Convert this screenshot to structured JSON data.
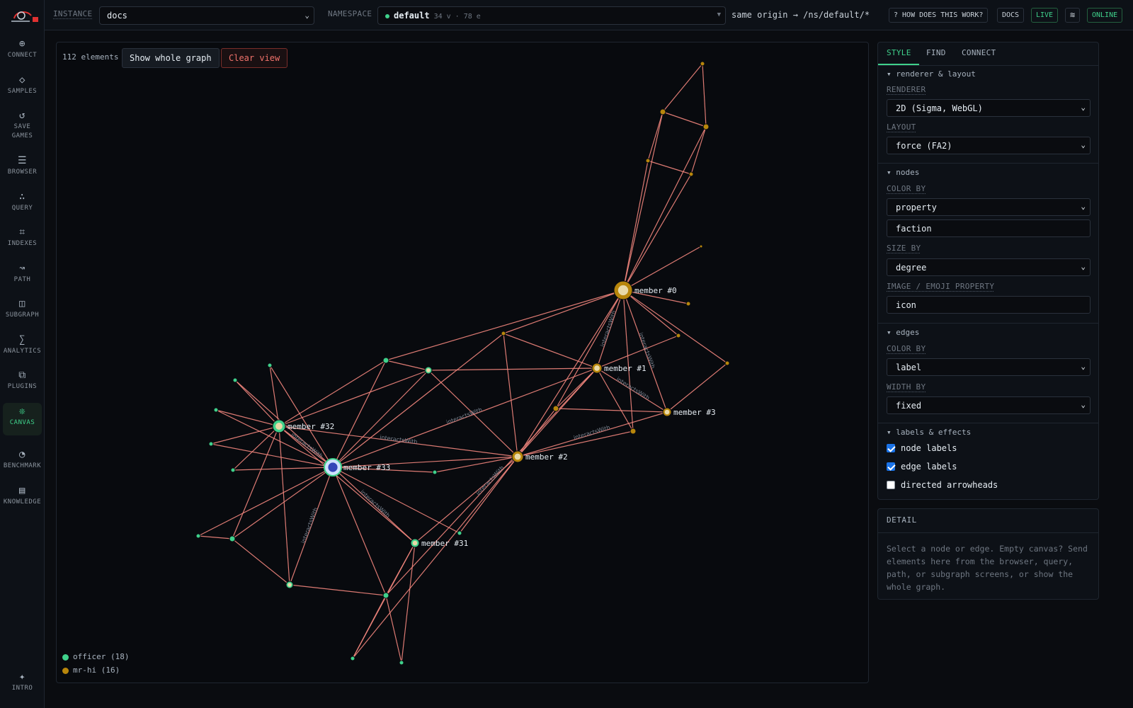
{
  "sidebar": {
    "items": [
      {
        "label": "CONNECT",
        "icon": "plug-icon",
        "glyph": "⊕"
      },
      {
        "label": "SAMPLES",
        "icon": "diamond-icon",
        "glyph": "◇"
      },
      {
        "label": "SAVE",
        "label2": "GAMES",
        "icon": "refresh-icon",
        "glyph": "↺"
      },
      {
        "label": "BROWSER",
        "icon": "list-icon",
        "glyph": "☰"
      },
      {
        "label": "QUERY",
        "icon": "dots-icon",
        "glyph": "∴"
      },
      {
        "label": "INDEXES",
        "icon": "grid-icon",
        "glyph": "⌗"
      },
      {
        "label": "PATH",
        "icon": "path-icon",
        "glyph": "↝"
      },
      {
        "label": "SUBGRAPH",
        "icon": "subgraph-icon",
        "glyph": "◫"
      },
      {
        "label": "ANALYTICS",
        "icon": "sigma-icon",
        "glyph": "∑"
      },
      {
        "label": "PLUGINS",
        "icon": "plugins-icon",
        "glyph": "⧉"
      },
      {
        "label": "CANVAS",
        "icon": "canvas-icon",
        "glyph": "❊"
      },
      {
        "label": "BENCHMARK",
        "icon": "gauge-icon",
        "glyph": "◔"
      },
      {
        "label": "KNOWLEDGE",
        "icon": "book-icon",
        "glyph": "▤"
      }
    ],
    "intro": {
      "label": "INTRO",
      "glyph": "✦"
    }
  },
  "topbar": {
    "instance_label": "INSTANCE",
    "instance_value": "docs",
    "namespace_label": "NAMESPACE",
    "namespace_value": "default",
    "namespace_stats": "34 v · 78 e",
    "origin": "same origin → /ns/default/*",
    "how": "? HOW DOES THIS WORK?",
    "docs": "DOCS",
    "live": "LIVE",
    "theme_glyph": "≋",
    "online": "ONLINE"
  },
  "canvas": {
    "count": "112 elements",
    "show_whole": "Show whole graph",
    "clear": "Clear view",
    "legend": [
      {
        "label": "officer (18)",
        "color": "#3fd18b"
      },
      {
        "label": "mr-hi (16)",
        "color": "#b8860b"
      }
    ]
  },
  "graph": {
    "edge_color": "#f4877e",
    "nodes": [
      {
        "id": "m0",
        "label": "member #0",
        "faction": "mr-hi",
        "emoji": "🧑"
      },
      {
        "id": "m1",
        "label": "member #1",
        "faction": "mr-hi",
        "emoji": "🙂"
      },
      {
        "id": "m2",
        "label": "member #2",
        "faction": "mr-hi",
        "emoji": "🙂"
      },
      {
        "id": "m3",
        "label": "member #3",
        "faction": "mr-hi",
        "emoji": "🙂"
      },
      {
        "id": "m31",
        "label": "member #31",
        "faction": "officer",
        "emoji": "🙂"
      },
      {
        "id": "m32",
        "label": "member #32",
        "faction": "officer",
        "emoji": "🙂"
      },
      {
        "id": "m33",
        "label": "member #33",
        "faction": "officer",
        "emoji": "🧍"
      }
    ],
    "edge_label": "interactsWith"
  },
  "style_panel": {
    "tabs": [
      "STYLE",
      "FIND",
      "CONNECT"
    ],
    "renderer_section": "▾ renderer & layout",
    "renderer_label": "RENDERER",
    "renderer_value": "2D (Sigma, WebGL)",
    "layout_label": "LAYOUT",
    "layout_value": "force (FA2)",
    "nodes_section": "▾ nodes",
    "color_by_label": "COLOR BY",
    "color_by_value": "property",
    "color_prop": "faction",
    "size_by_label": "SIZE BY",
    "size_by_value": "degree",
    "image_label": "IMAGE / EMOJI PROPERTY",
    "image_value": "icon",
    "edges_section": "▾ edges",
    "edge_color_label": "COLOR BY",
    "edge_color_value": "label",
    "width_label": "WIDTH BY",
    "width_value": "fixed",
    "labels_section": "▾ labels & effects",
    "node_labels": "node labels",
    "edge_labels": "edge labels",
    "arrowheads": "directed arrowheads"
  },
  "detail": {
    "title": "DETAIL",
    "text": "Select a node or edge. Empty canvas? Send elements here from the browser, query, path, or subgraph screens, or show the whole graph."
  }
}
